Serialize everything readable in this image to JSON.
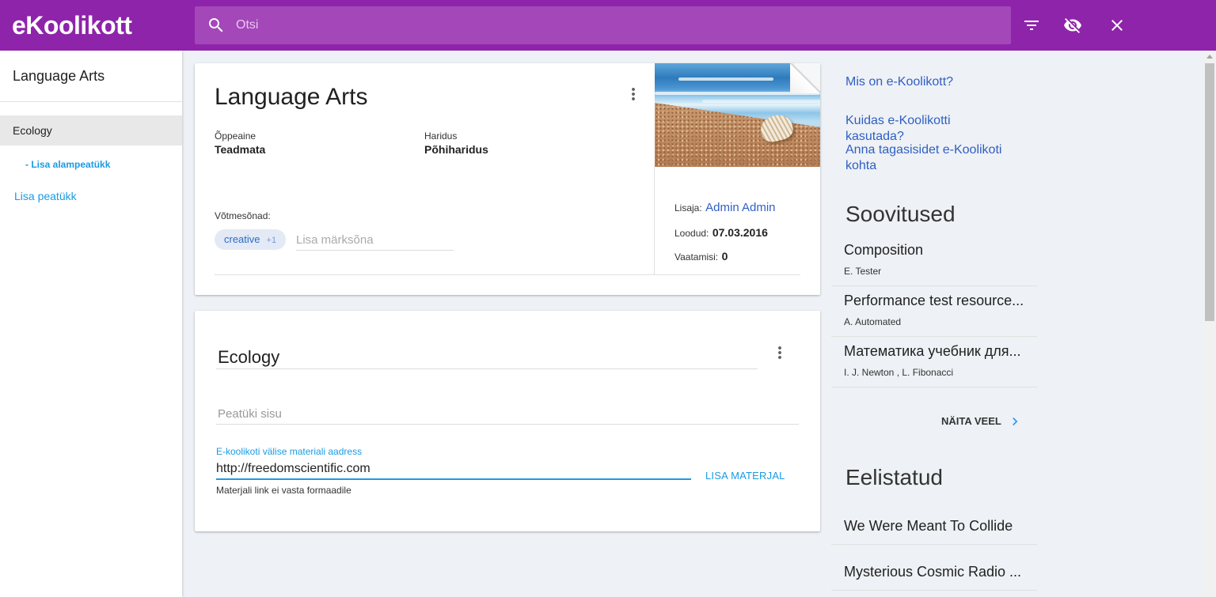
{
  "brand": {
    "logo_text": "eKoolikott"
  },
  "header": {
    "search": {
      "placeholder": "Otsi",
      "value": ""
    },
    "search_icon": "search-icon",
    "actions": [
      {
        "icon": "filter-icon"
      },
      {
        "icon": "visibility-off-icon"
      },
      {
        "icon": "close-icon"
      }
    ]
  },
  "colors": {
    "top_bar": "#8e24aa",
    "search_box": "#a347b9",
    "page_background": "#eef1f5",
    "accent_blue": "#1a9be3",
    "link_blue": "#2f5fc4",
    "chip_background": "#e3eaf5",
    "selected_item": "#e8e8e8"
  },
  "sidebar": {
    "title": "Language Arts",
    "chapters": [
      {
        "label": "Ecology",
        "selected": true,
        "add_subchapter_label": "- Lisa alampeatükk"
      }
    ],
    "add_chapter_label": "Lisa peatükk"
  },
  "portfolio": {
    "title": "Language Arts",
    "menu_icon": "more-vert-icon",
    "subject_label": "Õppeaine",
    "subject_value": "Teadmata",
    "education_label": "Haridus",
    "education_value": "Põhiharidus",
    "keywords_label": "Võtmesõnad:",
    "keywords": [
      {
        "label": "creative",
        "count": "+1"
      }
    ],
    "keyword_input_placeholder": "Lisa märksõna",
    "creator_label": "Lisaja:",
    "creator": "Admin Admin",
    "created_label": "Loodud:",
    "created": "07.03.2016",
    "views_label": "Vaatamisi:",
    "views": "0"
  },
  "chapter": {
    "title": "Ecology",
    "menu_icon": "more-vert-icon",
    "content_placeholder": "Peatüki sisu",
    "material_url_label": "E-koolikoti välise materiali aadress",
    "material_url_value": "http://freedomscientific.com",
    "add_material_button": "LISA MATERJAL",
    "error": "Materjali link ei vasta formaadile"
  },
  "help_links": [
    "Mis on e-Koolikott?",
    "Kuidas e-Koolikotti kasutada?",
    "Anna tagasisidet e-Koolikoti kohta"
  ],
  "recommendations": {
    "heading": "Soovitused",
    "items": [
      {
        "title": "Composition",
        "authors": "E. Tester"
      },
      {
        "title": "Performance test resource...",
        "authors": "A. Automated"
      },
      {
        "title": "Математика учебник для...",
        "authors": "I. J. Newton , L. Fibonacci"
      }
    ],
    "show_more": "NÄITA VEEL"
  },
  "favorites": {
    "heading": "Eelistatud",
    "items": [
      {
        "title": "We Were Meant To Collide"
      },
      {
        "title": "Mysterious Cosmic Radio ..."
      }
    ]
  }
}
